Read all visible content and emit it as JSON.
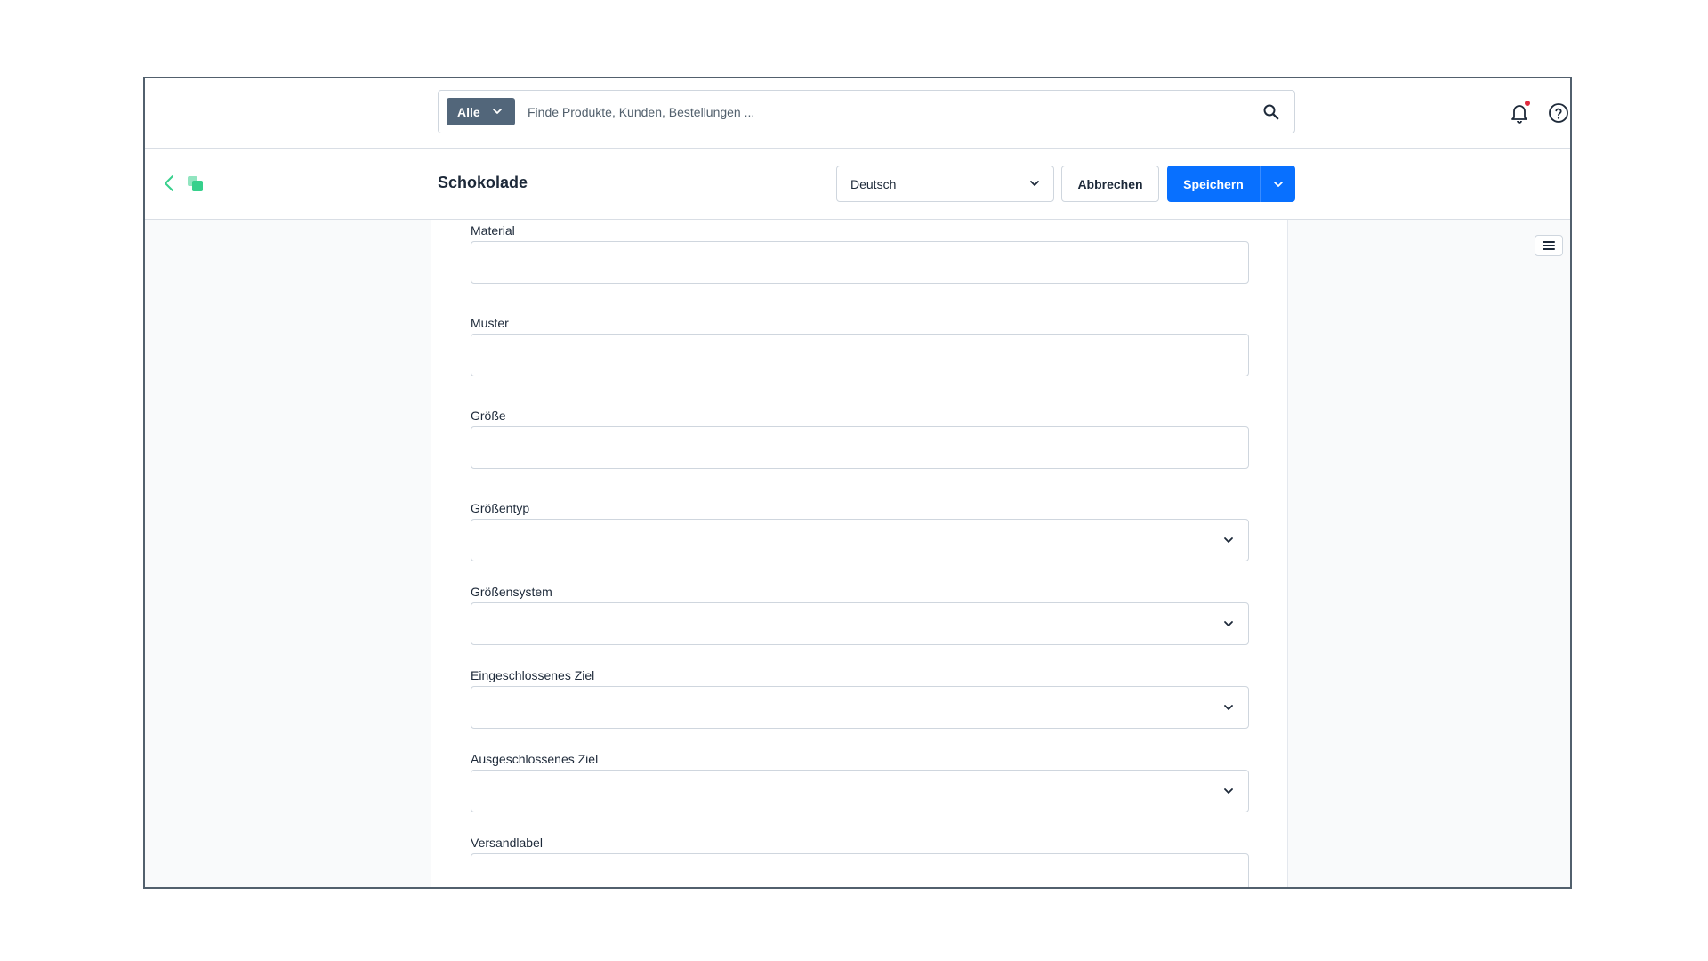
{
  "topbar": {
    "search_scope": "Alle",
    "search_placeholder": "Finde Produkte, Kunden, Bestellungen ..."
  },
  "smartbar": {
    "title": "Schokolade",
    "language": "Deutsch",
    "cancel_label": "Abbrechen",
    "save_label": "Speichern"
  },
  "form": {
    "fields": [
      {
        "label": "Material",
        "type": "text",
        "value": ""
      },
      {
        "label": "Muster",
        "type": "text",
        "value": ""
      },
      {
        "label": "Größe",
        "type": "text",
        "value": ""
      },
      {
        "label": "Größentyp",
        "type": "select",
        "value": ""
      },
      {
        "label": "Größensystem",
        "type": "select",
        "value": ""
      },
      {
        "label": "Eingeschlossenes Ziel",
        "type": "select",
        "value": ""
      },
      {
        "label": "Ausgeschlossenes Ziel",
        "type": "select",
        "value": ""
      },
      {
        "label": "Versandlabel",
        "type": "text",
        "value": ""
      }
    ]
  },
  "colors": {
    "primary": "#0870ff",
    "scope_bg": "#52667a",
    "accent_green": "#37d08c",
    "notification": "#e0293d",
    "frame_border": "#52606d"
  },
  "icons": {
    "search": "search-icon",
    "bell": "bell-icon",
    "help": "help-icon",
    "back": "chevron-left-icon",
    "copy": "copy-icon",
    "sidebar": "hamburger-icon"
  }
}
